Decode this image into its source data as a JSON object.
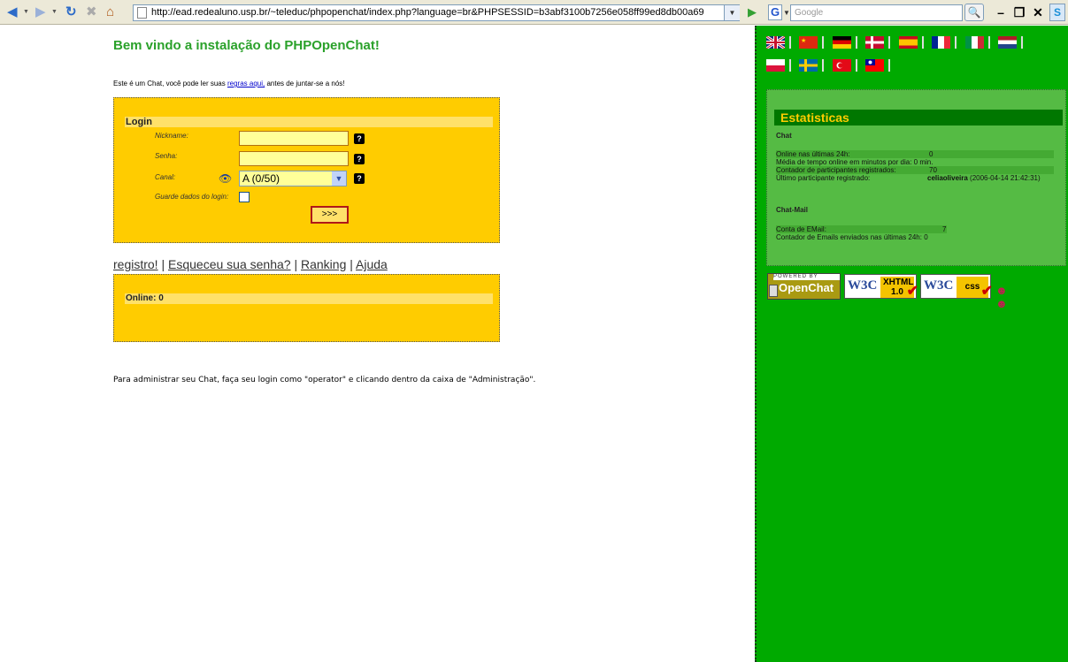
{
  "browser": {
    "url": "http://ead.redealuno.usp.br/~teleduc/phpopenchat/index.php?language=br&PHPSESSID=b3abf3100b7256e058ff99ed8db00a69",
    "search_placeholder": "Google",
    "search_engine_logo": "G"
  },
  "page": {
    "title": "Bem vindo a instalação do PHPOpenChat!",
    "intro_before": "Este é um Chat, você pode ler suas ",
    "intro_link": "regras aqui,",
    "intro_after": " antes de juntar-se a nós!"
  },
  "login": {
    "heading": "Login",
    "nickname_label": "Nickname:",
    "password_label": "Senha:",
    "channel_label": "Canal:",
    "channel_selected": "A (0/50)",
    "remember_label": "Guarde dados do login:",
    "submit_label": ">>>",
    "help_glyph": "?"
  },
  "links": {
    "register": "registro!",
    "forgot": "Esqueceu sua senha?",
    "ranking": "Ranking",
    "help": "Ajuda",
    "sep": "|"
  },
  "online": {
    "label": "Online: 0"
  },
  "admin_note": "Para administrar seu Chat, faça seu login como \"operator\" e clicando dentro da caixa de \"Administração\".",
  "flags": [
    "uk",
    "china",
    "germany",
    "denmark",
    "spain",
    "france",
    "italy",
    "netherlands",
    "poland",
    "sweden",
    "turkey",
    "taiwan"
  ],
  "stats": {
    "title": "Estatisticas",
    "chat_heading": "Chat",
    "rows": [
      {
        "label": "Online nas últimas 24h:",
        "value": "0"
      },
      {
        "label": "Média de tempo online em minutos por dia:",
        "value": "0 min."
      },
      {
        "label": "Contador de participantes registrados:",
        "value": "70"
      },
      {
        "label": "Último participante registrado:",
        "value_bold": "celiaoliveira",
        "value": "(2006-04-14 21:42:31)"
      }
    ],
    "mail_heading": "Chat-Mail",
    "mail_rows": [
      {
        "label": "Conta de EMail:",
        "value": "7"
      },
      {
        "label": "Contador de Emails enviados nas últimas 24h:",
        "value": "0"
      }
    ]
  },
  "badges": {
    "openchat_top": "POWERED BY",
    "openchat_main": "OpenChat",
    "w3c": "W3C",
    "xhtml": "XHTML",
    "xhtml_version": "1.0",
    "css": "css"
  }
}
